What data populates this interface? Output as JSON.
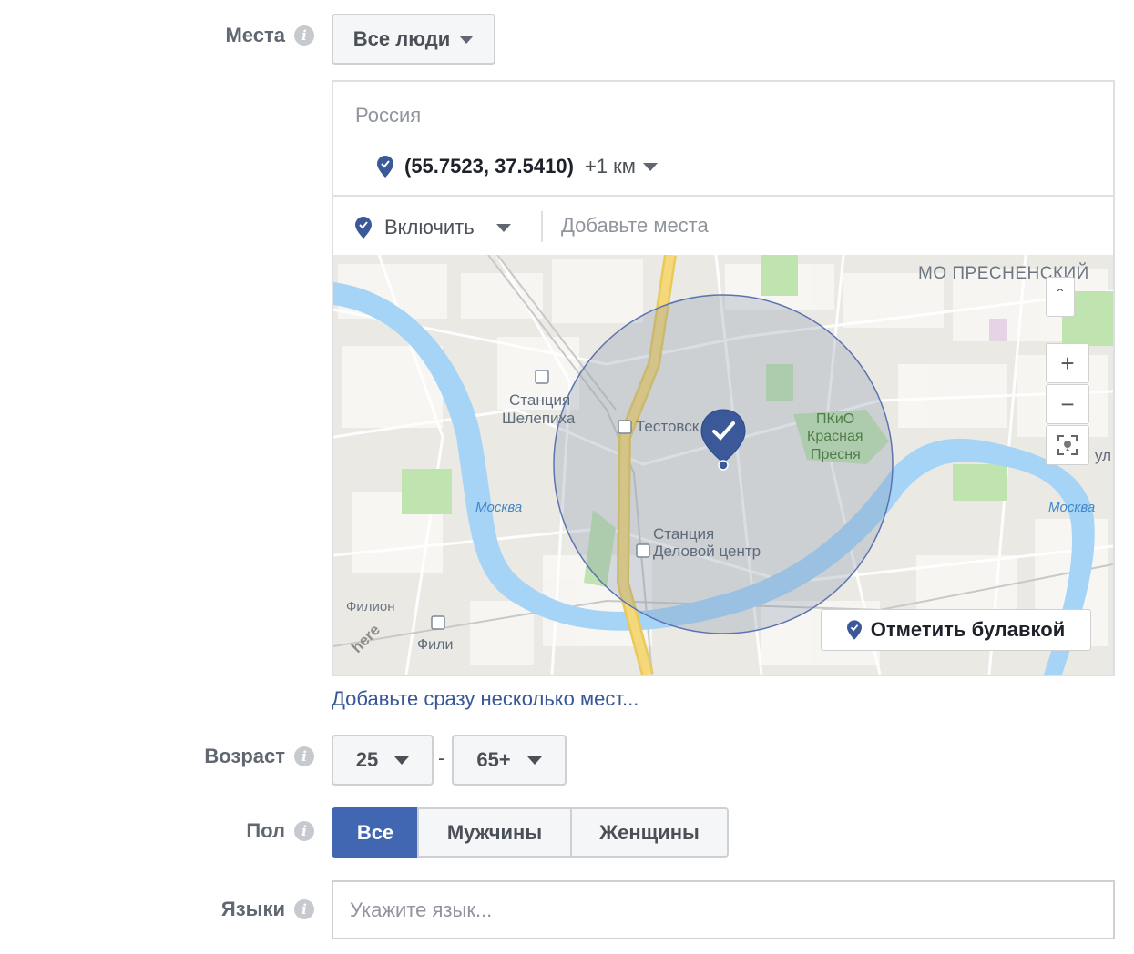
{
  "places": {
    "label": "Места",
    "audience_dropdown": "Все люди",
    "country": "Россия",
    "location": {
      "coords": "(55.7523, 37.5410)",
      "radius": "+1 км"
    },
    "include_dropdown": "Включить",
    "add_places_placeholder": "Добавьте места",
    "add_multiple_link": "Добавьте сразу несколько мест..."
  },
  "map": {
    "labels": {
      "district": "МО ПРЕСНЕНСКИЙ",
      "station_shelepikha_1": "Станция",
      "station_shelepikha_2": "Шелепиха",
      "testovskaya": "Тестовск",
      "park_1": "ПКиО",
      "park_2": "Красная",
      "park_3": "Пресня",
      "river_left": "Москва",
      "river_right": "Москва",
      "station_dc_1": "Станция",
      "station_dc_2": "Деловой центр",
      "filion": "Филион",
      "fili": "Фили",
      "edge_ul": "ул",
      "here_logo": "here"
    },
    "drop_pin_button": "Отметить булавкой",
    "zoom_in": "+",
    "zoom_out": "−",
    "collapse": "ˆ"
  },
  "age": {
    "label": "Возраст",
    "min": "25",
    "separator": "-",
    "max": "65+"
  },
  "gender": {
    "label": "Пол",
    "options": [
      "Все",
      "Мужчины",
      "Женщины"
    ],
    "selected": "Все"
  },
  "languages": {
    "label": "Языки",
    "placeholder": "Укажите язык..."
  },
  "colors": {
    "accent": "#4267b2",
    "pin": "#3b5998",
    "link": "#365899",
    "water": "#a6d4f7",
    "park": "#bfe4b0",
    "road_major": "#f5d87a"
  },
  "info_icon_glyph": "i"
}
